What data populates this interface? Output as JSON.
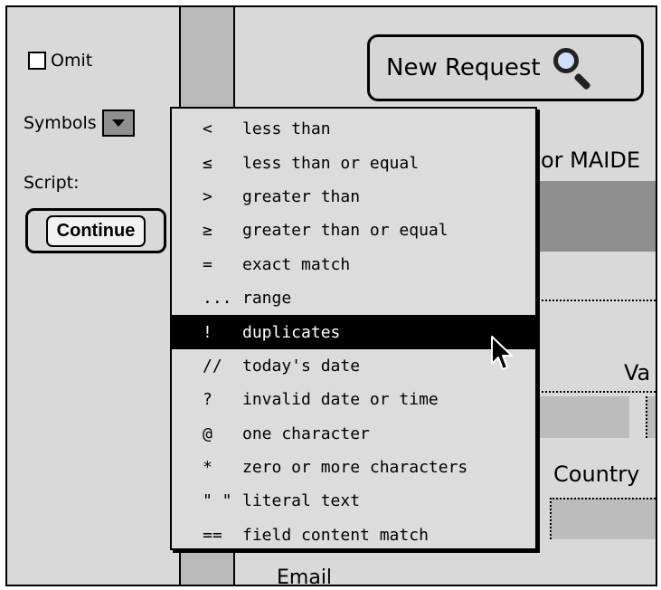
{
  "left_panel": {
    "omit_label": "Omit",
    "symbols_label": "Symbols",
    "script_label": "Script:",
    "continue_label": "Continue"
  },
  "toolbar": {
    "new_request_label": "New Request"
  },
  "form": {
    "maiden_label": "or MAIDE",
    "va_label": "Va",
    "country_label": "Country",
    "email_label": "Email"
  },
  "symbols_menu": {
    "selected_index": 6,
    "items": [
      {
        "symbol": "<",
        "label": "less than"
      },
      {
        "symbol": "≤",
        "label": "less than or equal"
      },
      {
        "symbol": ">",
        "label": "greater than"
      },
      {
        "symbol": "≥",
        "label": "greater than or equal"
      },
      {
        "symbol": "=",
        "label": "exact match"
      },
      {
        "symbol": "...",
        "label": "range"
      },
      {
        "symbol": "!",
        "label": "duplicates"
      },
      {
        "symbol": "//",
        "label": "today's date"
      },
      {
        "symbol": "?",
        "label": "invalid date or time"
      },
      {
        "symbol": "@",
        "label": "one character"
      },
      {
        "symbol": "*",
        "label": "zero or more characters"
      },
      {
        "symbol": "\" \"",
        "label": "literal text"
      },
      {
        "symbol": "==",
        "label": "field content match"
      }
    ]
  }
}
